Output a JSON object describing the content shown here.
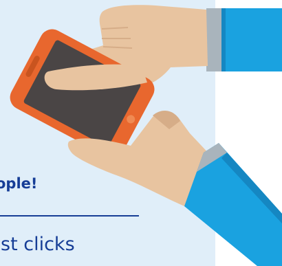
{
  "illustration": {
    "description_icon": "hand-tapping-smartphone-icon",
    "colors": {
      "panel_background": "#e0eef9",
      "sleeve_blue": "#1aa2e0",
      "sleeve_shadow": "#1587c2",
      "cuff_gray": "#a9b4bc",
      "skin": "#e8c4a0",
      "skin_shadow": "#d6ad88",
      "phone_body": "#e8672e",
      "phone_screen": "#4a4545",
      "headline_text": "#163d96"
    }
  },
  "content": {
    "headline": "ople!",
    "subtext": "st clicks"
  }
}
